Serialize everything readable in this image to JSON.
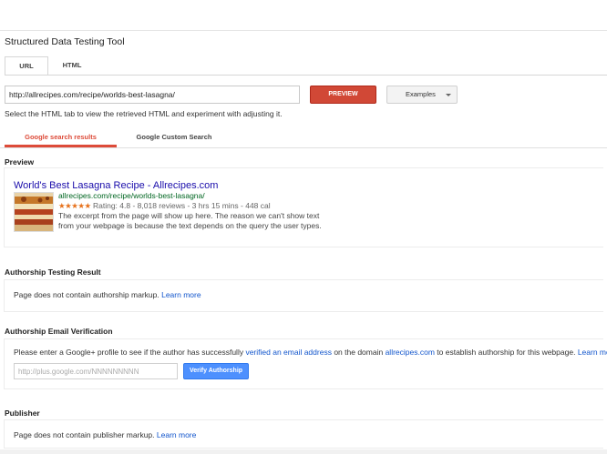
{
  "app_title": "Structured Data Testing Tool",
  "input_tabs": [
    {
      "label": "URL",
      "active": true
    },
    {
      "label": "HTML",
      "active": false
    }
  ],
  "url_input": {
    "value": "http://allrecipes.com/recipe/worlds-best-lasagna/"
  },
  "preview_button": "PREVIEW",
  "examples_button": "Examples",
  "hint": "Select the HTML tab to view the retrieved HTML and experiment with adjusting it.",
  "result_tabs": [
    {
      "label": "Google search results",
      "active": true
    },
    {
      "label": "Google Custom Search",
      "active": false
    }
  ],
  "preview": {
    "heading": "Preview",
    "result_title": "World's Best Lasagna Recipe - Allrecipes.com",
    "result_url": "allrecipes.com/recipe/worlds-best-lasagna/",
    "stars": "★★★★★",
    "rating_text": "Rating: 4.8 - 8,018 reviews - 3 hrs 15 mins - 448 cal",
    "snippet": "The excerpt from the page will show up here. The reason we can't show text from your webpage is because the text depends on the query the user types."
  },
  "authorship_testing": {
    "heading": "Authorship Testing Result",
    "message": "Page does not contain authorship markup.",
    "learn_more": "Learn more"
  },
  "authorship_email": {
    "heading": "Authorship Email Verification",
    "text_before": "Please enter a Google+ profile to see if the author has successfully",
    "link_verified": "verified an email address",
    "text_middle": "on the domain",
    "link_domain": "allrecipes.com",
    "text_after": "to establish authorship for this webpage.",
    "learn_more": "Learn more",
    "placeholder": "http://plus.google.com/NNNNNNNNN",
    "verify_button": "Verify Authorship"
  },
  "publisher": {
    "heading": "Publisher",
    "message": "Page does not contain publisher markup.",
    "learn_more": "Learn more"
  },
  "colors": {
    "preview_button": "#d14836",
    "active_tab": "#dd4b39",
    "link": "#1a0dab",
    "url_green": "#006621",
    "verify_button": "#4d90fe",
    "stars": "#e7711b"
  }
}
